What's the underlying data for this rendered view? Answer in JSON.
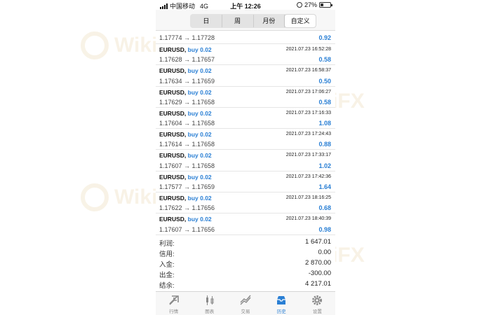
{
  "status_bar": {
    "carrier": "中国移动",
    "network": "4G",
    "time": "上午 12:26",
    "battery": "27%"
  },
  "tabs_top": {
    "items": [
      "日",
      "周",
      "月份",
      "自定义"
    ],
    "active": "自定义"
  },
  "first_partial": {
    "prices": "1.17774 → 1.17728",
    "profit": "0.92"
  },
  "trades": [
    {
      "symbol": "EURUSD,",
      "side": "buy 0.02",
      "time": "2021.07.23 16:52:28",
      "prices": "1.17628 → 1.17657",
      "profit": "0.58"
    },
    {
      "symbol": "EURUSD,",
      "side": "buy 0.02",
      "time": "2021.07.23 16:58:37",
      "prices": "1.17634 → 1.17659",
      "profit": "0.50"
    },
    {
      "symbol": "EURUSD,",
      "side": "buy 0.02",
      "time": "2021.07.23 17:06:27",
      "prices": "1.17629 → 1.17658",
      "profit": "0.58"
    },
    {
      "symbol": "EURUSD,",
      "side": "buy 0.02",
      "time": "2021.07.23 17:16:33",
      "prices": "1.17604 → 1.17658",
      "profit": "1.08"
    },
    {
      "symbol": "EURUSD,",
      "side": "buy 0.02",
      "time": "2021.07.23 17:24:43",
      "prices": "1.17614 → 1.17658",
      "profit": "0.88"
    },
    {
      "symbol": "EURUSD,",
      "side": "buy 0.02",
      "time": "2021.07.23 17:33:17",
      "prices": "1.17607 → 1.17658",
      "profit": "1.02"
    },
    {
      "symbol": "EURUSD,",
      "side": "buy 0.02",
      "time": "2021.07.23 17:42:36",
      "prices": "1.17577 → 1.17659",
      "profit": "1.64"
    },
    {
      "symbol": "EURUSD,",
      "side": "buy 0.02",
      "time": "2021.07.23 18:16:25",
      "prices": "1.17622 → 1.17656",
      "profit": "0.68"
    },
    {
      "symbol": "EURUSD,",
      "side": "buy 0.02",
      "time": "2021.07.23 18:40:39",
      "prices": "1.17607 → 1.17656",
      "profit": "0.98"
    }
  ],
  "summary": [
    {
      "label": "利润:",
      "value": "1 647.01"
    },
    {
      "label": "信用:",
      "value": "0.00"
    },
    {
      "label": "入金:",
      "value": "2 870.00"
    },
    {
      "label": "出金:",
      "value": "-300.00"
    },
    {
      "label": "结余:",
      "value": "4 217.01"
    }
  ],
  "tab_bar": [
    {
      "label": "行情",
      "icon": "quotes-icon",
      "active": false
    },
    {
      "label": "图表",
      "icon": "chart-icon",
      "active": false
    },
    {
      "label": "交易",
      "icon": "trade-icon",
      "active": false
    },
    {
      "label": "历史",
      "icon": "history-icon",
      "active": true
    },
    {
      "label": "设置",
      "icon": "settings-icon",
      "active": false
    }
  ],
  "watermark": "WikiFX",
  "colors": {
    "accent": "#2a7fd4",
    "watermark": "#c79a3a"
  }
}
